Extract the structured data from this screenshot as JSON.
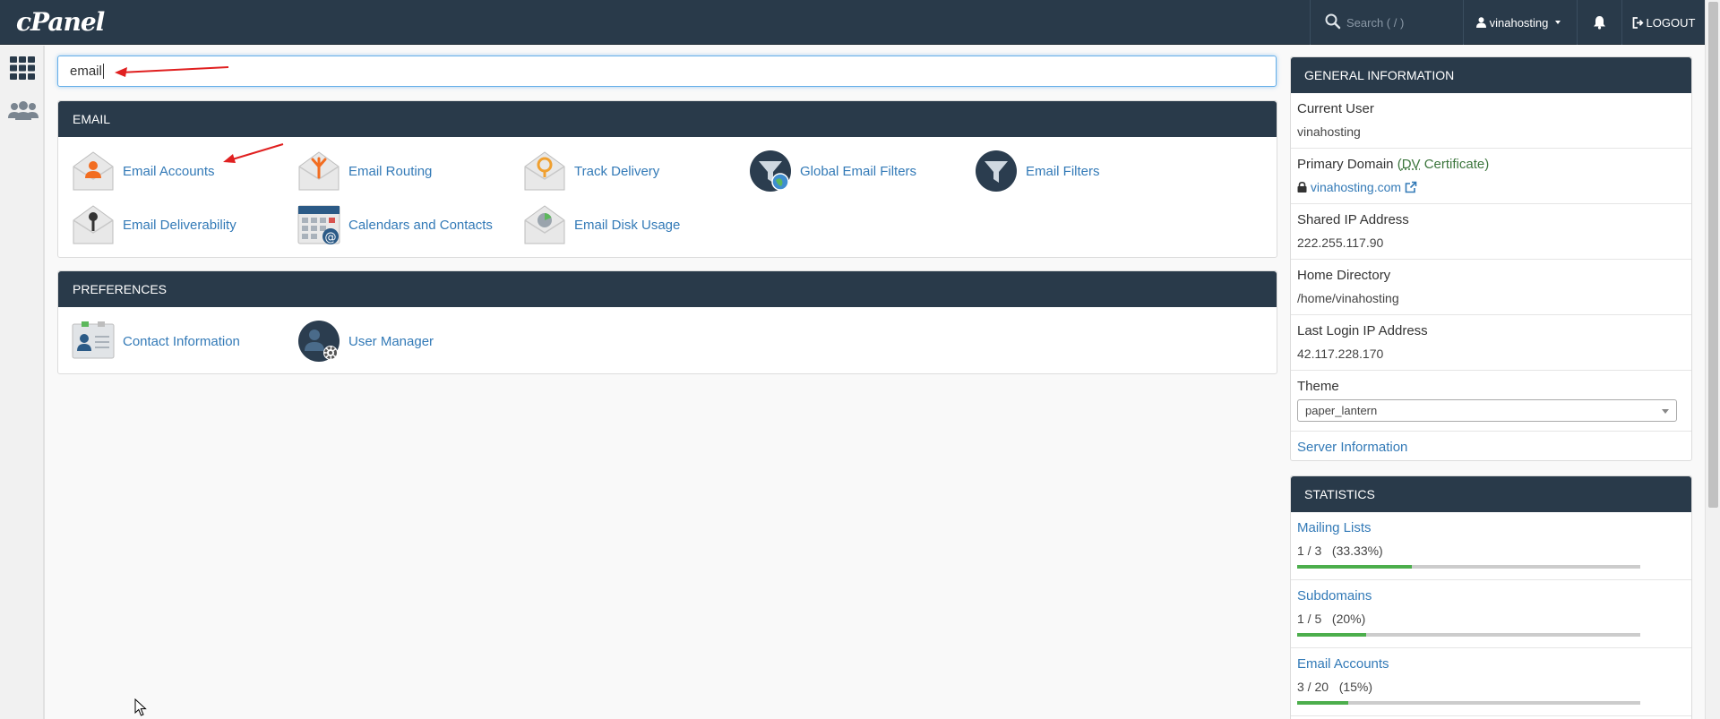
{
  "topbar": {
    "logo": "cPanel",
    "search_placeholder": "Search ( / )",
    "username": "vinahosting",
    "logout": "LOGOUT"
  },
  "search": {
    "value": "email"
  },
  "email_panel": {
    "title": "EMAIL",
    "items": [
      {
        "label": "Email Accounts",
        "icon": "email-accounts-icon"
      },
      {
        "label": "Email Routing",
        "icon": "email-routing-icon"
      },
      {
        "label": "Track Delivery",
        "icon": "track-delivery-icon"
      },
      {
        "label": "Global Email Filters",
        "icon": "global-email-filters-icon"
      },
      {
        "label": "Email Filters",
        "icon": "email-filters-icon"
      },
      {
        "label": "Email Deliverability",
        "icon": "email-deliverability-icon"
      },
      {
        "label": "Calendars and Contacts",
        "icon": "calendars-contacts-icon"
      },
      {
        "label": "Email Disk Usage",
        "icon": "email-disk-usage-icon"
      }
    ]
  },
  "preferences_panel": {
    "title": "PREFERENCES",
    "items": [
      {
        "label": "Contact Information",
        "icon": "contact-information-icon"
      },
      {
        "label": "User Manager",
        "icon": "user-manager-icon"
      }
    ]
  },
  "general_info": {
    "title": "GENERAL INFORMATION",
    "current_user_label": "Current User",
    "current_user": "vinahosting",
    "primary_domain_label": "Primary Domain",
    "cert_open": "(",
    "cert_dv": "DV",
    "cert_rest": " Certificate)",
    "primary_domain": "vinahosting.com",
    "shared_ip_label": "Shared IP Address",
    "shared_ip": "222.255.117.90",
    "home_dir_label": "Home Directory",
    "home_dir": "/home/vinahosting",
    "last_login_label": "Last Login IP Address",
    "last_login": "42.117.228.170",
    "theme_label": "Theme",
    "theme": "paper_lantern",
    "server_info": "Server Information"
  },
  "statistics": {
    "title": "STATISTICS",
    "rows": [
      {
        "label": "Mailing Lists",
        "value": "1 / 3   (33.33%)",
        "pct": 33.33
      },
      {
        "label": "Subdomains",
        "value": "1 / 5   (20%)",
        "pct": 20
      },
      {
        "label": "Email Accounts",
        "value": "3 / 20   (15%)",
        "pct": 15
      }
    ]
  },
  "colors": {
    "header": "#293a4a",
    "link": "#337ab7",
    "progress": "#4cae4c",
    "annotation": "#e02020"
  }
}
